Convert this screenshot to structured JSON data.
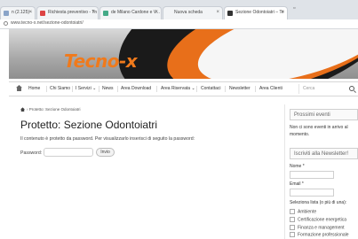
{
  "browser": {
    "tabs": [
      {
        "title": "n (2.125) - "
      },
      {
        "title": "Richiesta preventivo - Tn"
      },
      {
        "title": "de Milano Cardone e V..."
      },
      {
        "title": "Nuova scheda"
      },
      {
        "title": "Sezione Odontoiatri – Te"
      }
    ],
    "url": "www.tecno-x.net/sezione-odontoiatri/"
  },
  "header": {
    "logo": "Tecno-x"
  },
  "nav": {
    "items": [
      "Home",
      "Chi Siamo",
      "I Servizi ⌄",
      "News",
      "Area Download",
      "Area Riservata ⌄",
      "Contattaci",
      "Newsletter",
      "Area Clienti"
    ],
    "search_placeholder": "Cerca"
  },
  "breadcrumb": "› Protetto: Sezione Odontoiatri",
  "main": {
    "title": "Protetto: Sezione Odontoiatri",
    "protected_text": "Il contenuto è protetto da password. Per visualizzarlo inserisci di seguito la password:",
    "password_label": "Password:",
    "submit_label": "Invio"
  },
  "sidebar": {
    "events_title": "Prossimi eventi",
    "events_text_1": "Non ci sono eventi in arrivo al",
    "events_text_2": "momento.",
    "newsletter_title": "Iscriviti alla Newsletter!",
    "name_label": "Nome *",
    "email_label": "Email *",
    "lists_label": "Seleziona lista (o più di una):",
    "lists": [
      "Ambiente",
      "Certificazione energetica",
      "Finanza e management",
      "Formazione professionale"
    ]
  }
}
